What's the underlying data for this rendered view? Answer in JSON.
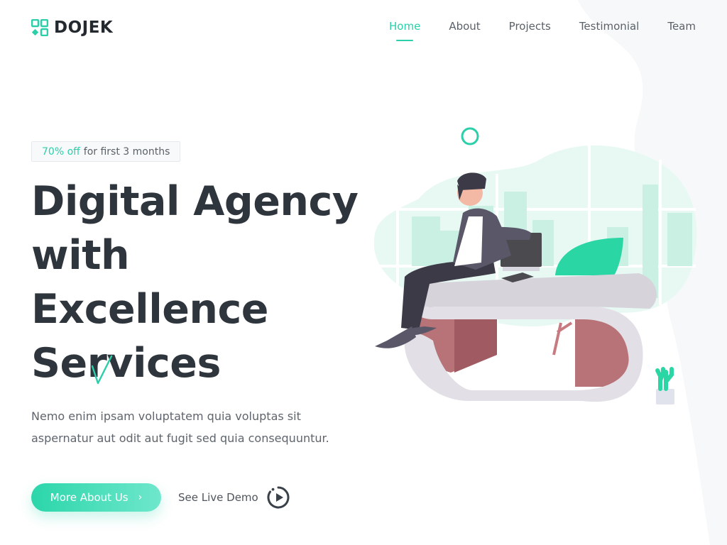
{
  "brand": {
    "name": "DOJEK",
    "accent": "#2bcfa9",
    "text": "#2f353c"
  },
  "nav": {
    "items": [
      {
        "label": "Home",
        "active": true
      },
      {
        "label": "About",
        "active": false
      },
      {
        "label": "Projects",
        "active": false
      },
      {
        "label": "Testimonial",
        "active": false
      },
      {
        "label": "Team",
        "active": false
      }
    ]
  },
  "hero": {
    "badge": {
      "highlight": "70% off",
      "text": "for first 3 months"
    },
    "title_lines": [
      "Digital Agency",
      "with",
      "Excellence",
      "Services"
    ],
    "description": "Nemo enim ipsam voluptatem quia voluptas sit aspernatur aut odit aut fugit sed quia consequuntur.",
    "primary_button": {
      "label": "More About Us",
      "icon": "chevron-right-icon"
    },
    "secondary_link": {
      "label": "See Live Demo",
      "icon": "play-circle-icon"
    }
  }
}
